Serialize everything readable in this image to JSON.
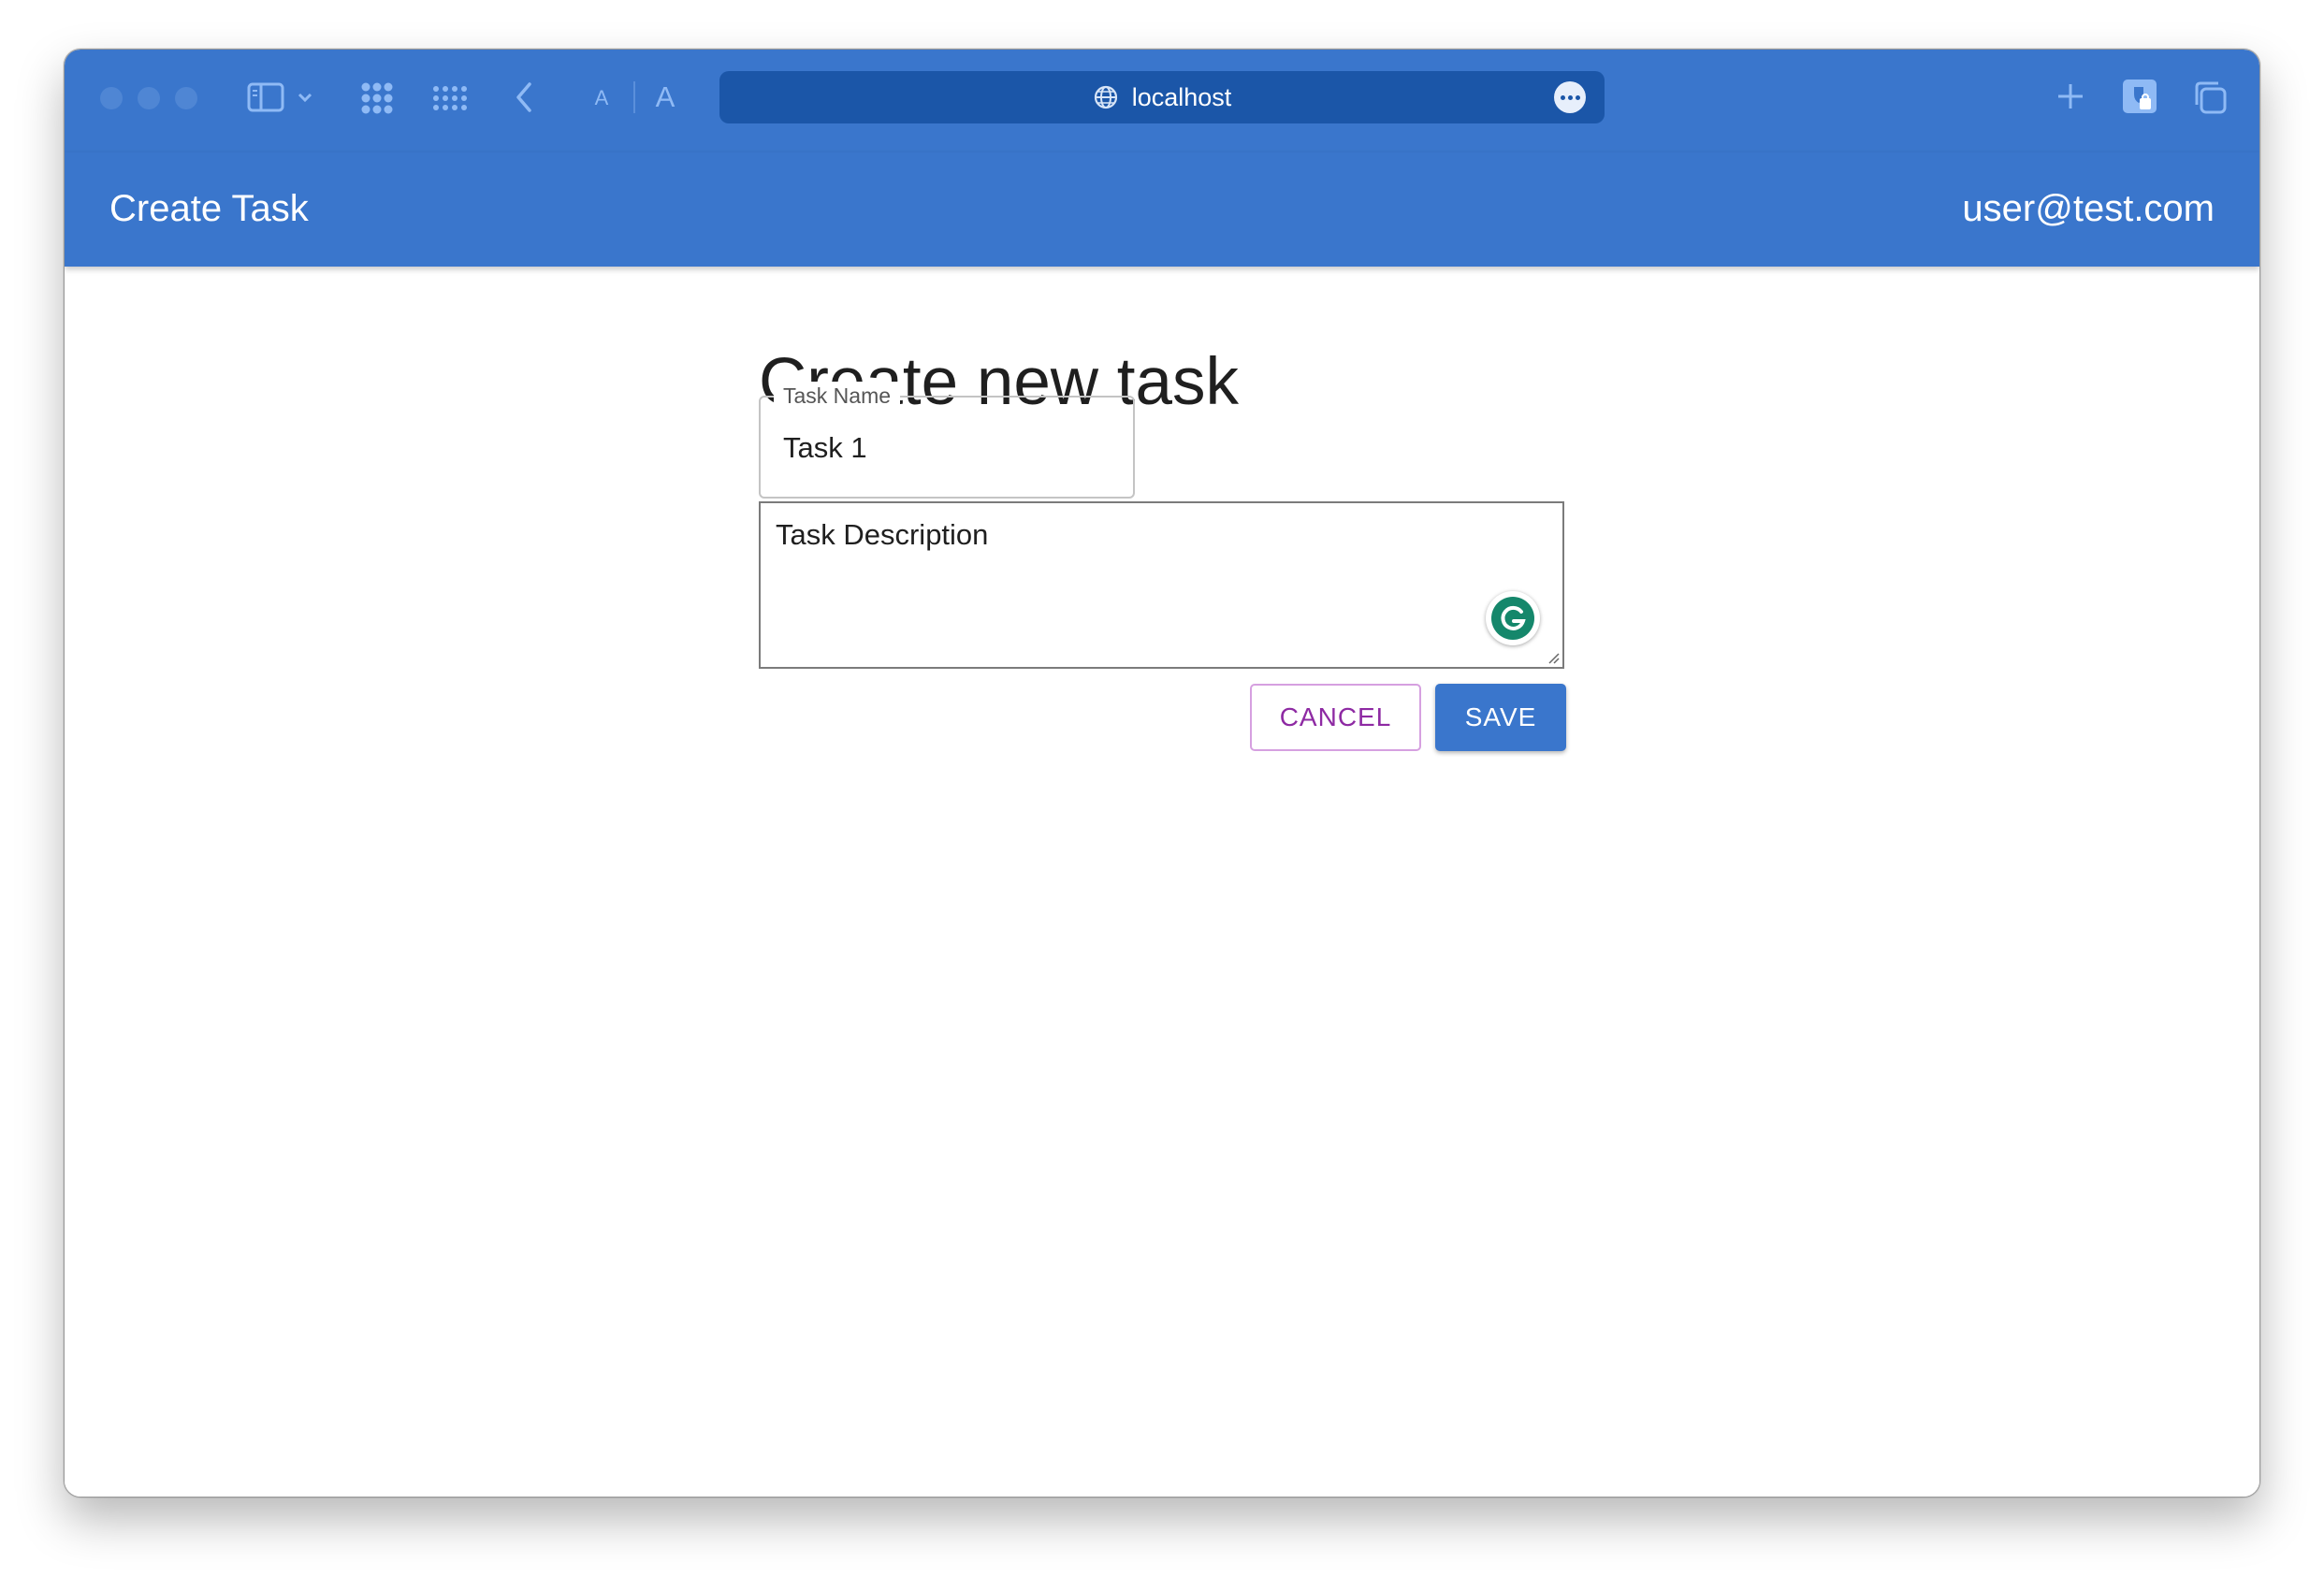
{
  "browser": {
    "address": "localhost",
    "colors": {
      "toolbar": "#3a76cc",
      "address_bar": "#1b56a8",
      "icon": "#8fbaf5"
    },
    "icons": [
      "sidebar-icon",
      "chevron-down-icon",
      "tab-overview-icon",
      "extensions-grid-icon",
      "back-icon",
      "text-smaller-icon",
      "text-larger-icon",
      "globe-icon",
      "more-icon",
      "new-tab-icon",
      "privacy-report-icon",
      "tabs-icon"
    ]
  },
  "appbar": {
    "title": "Create Task",
    "user": "user@test.com",
    "color": "#3a76cc"
  },
  "form": {
    "heading": "Create new task",
    "task_name_label": "Task Name",
    "task_name_value": "Task 1",
    "description_placeholder": "Task Description",
    "cancel_label": "CANCEL",
    "save_label": "SAVE",
    "cancel_color": "#8e2aa3",
    "save_color": "#3a76cc"
  }
}
